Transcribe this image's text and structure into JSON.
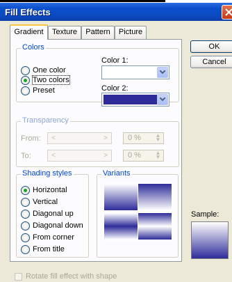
{
  "window": {
    "title": "Fill Effects"
  },
  "tabs": [
    {
      "label": "Gradient",
      "active": true
    },
    {
      "label": "Texture"
    },
    {
      "label": "Pattern"
    },
    {
      "label": "Picture"
    }
  ],
  "colors_group": {
    "title": "Colors",
    "options": [
      "One color",
      "Two colors",
      "Preset"
    ],
    "selected": "Two colors",
    "color1_label": "Color 1:",
    "color1_value": "#FFFFFF",
    "color2_label": "Color 2:",
    "color2_value": "#2E2C99"
  },
  "transparency_group": {
    "title": "Transparency",
    "from_label": "From:",
    "to_label": "To:",
    "from_value": "0 %",
    "to_value": "0 %"
  },
  "shading_group": {
    "title": "Shading styles",
    "options": [
      "Horizontal",
      "Vertical",
      "Diagonal up",
      "Diagonal down",
      "From corner",
      "From title"
    ],
    "selected": "Horizontal"
  },
  "variants_group": {
    "title": "Variants"
  },
  "buttons": {
    "ok": "OK",
    "cancel": "Cancel"
  },
  "sample_label": "Sample:",
  "rotate_label": "Rotate fill effect with shape",
  "icons": {
    "close": "close-icon",
    "dropdown": "chevron-down-icon"
  },
  "colors": {
    "titlebar": "#0A4FCB",
    "gradient_dark": "#2E2C99",
    "selected_radio": "#21A121"
  }
}
